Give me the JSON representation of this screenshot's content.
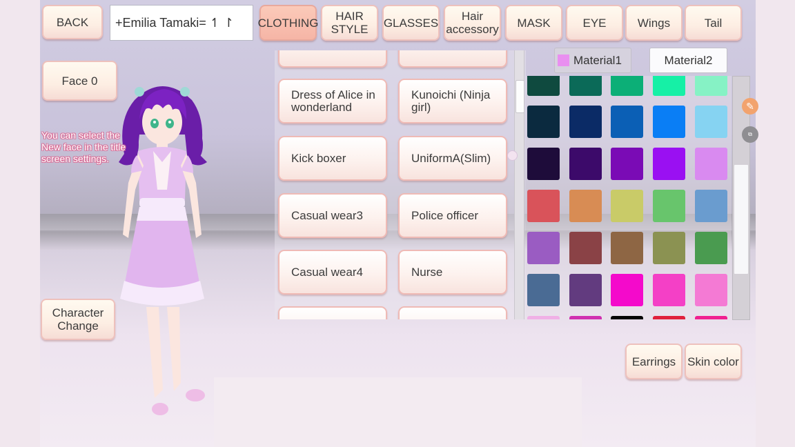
{
  "top_bar": {
    "back": "BACK",
    "name": "+Emilia Tamaki= ↿ ↾",
    "tabs": [
      {
        "label": "CLOTHING",
        "active": true
      },
      {
        "label": "HAIR STYLE",
        "active": false
      },
      {
        "label": "GLASSES",
        "active": false
      },
      {
        "label": "Hair accessory",
        "active": false
      },
      {
        "label": "MASK",
        "active": false
      },
      {
        "label": "EYE",
        "active": false
      },
      {
        "label": "Wings",
        "active": false
      },
      {
        "label": "Tail",
        "active": false
      }
    ]
  },
  "left": {
    "face_label": "Face",
    "face_value": "0",
    "hint": "You can select the New face in the title screen settings.",
    "character_change": "Character Change"
  },
  "outfits": [
    {
      "label": "Dress of Alice in wonderland"
    },
    {
      "label": "Kunoichi (Ninja girl)"
    },
    {
      "label": "Kick boxer"
    },
    {
      "label": "UniformA(Slim)"
    },
    {
      "label": "Casual wear3"
    },
    {
      "label": "Police officer"
    },
    {
      "label": "Casual wear4"
    },
    {
      "label": "Nurse"
    }
  ],
  "materials": {
    "tab1": "Material1",
    "tab2": "Material2",
    "selected_color": "#e98ff0"
  },
  "palette": [
    [
      "#0f4a3f",
      "#0b6a58",
      "#0caf77",
      "#16f0a6",
      "#86f2c5"
    ],
    [
      "#0b2a3f",
      "#0b2b66",
      "#0b5fb5",
      "#0a7ef5",
      "#86d3f2"
    ],
    [
      "#1e0c3a",
      "#3c0a6a",
      "#7a0bb5",
      "#9a10f2",
      "#d98af0"
    ],
    [
      "#d9535a",
      "#d88c54",
      "#c9cb68",
      "#68c56c",
      "#6a9ccf"
    ],
    [
      "#9a5cc2",
      "#8a4246",
      "#8e6644",
      "#8b9252",
      "#4a9b50"
    ],
    [
      "#4a6b94",
      "#623b7f",
      "#f40acb",
      "#f440c6",
      "#f47ad4"
    ],
    [
      "#f0b0e6",
      "#d030b0",
      "#050505",
      "#e0203c",
      "#f02090"
    ]
  ],
  "bottom_right": {
    "earrings": "Earrings",
    "skin_color": "Skin color"
  },
  "icons": {
    "brush": "paint-brush-icon",
    "copy": "copy-icon"
  }
}
